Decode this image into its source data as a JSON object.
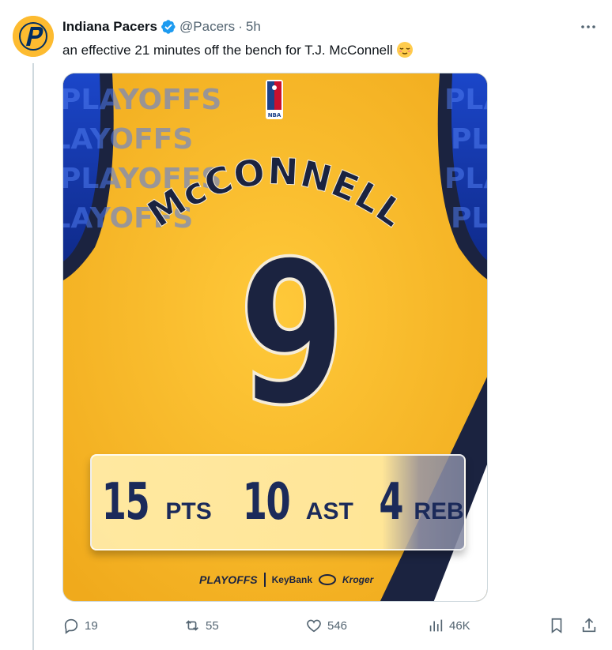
{
  "tweet": {
    "author_name": "Indiana Pacers",
    "handle": "@Pacers",
    "separator": "·",
    "time": "5h",
    "text": "an effective 21 minutes off the bench for T.J. McConnell"
  },
  "media": {
    "league_logo_text": "NBA",
    "background_text": "PLAYOFFS",
    "jersey_name": "McCONNELL",
    "jersey_number": "9",
    "stats": [
      {
        "value": "15",
        "label": "PTS"
      },
      {
        "value": "10",
        "label": "AST"
      },
      {
        "value": "4",
        "label": "REB"
      }
    ],
    "sponsors": {
      "playoffs": "PLAYOFFS",
      "keybank": "KeyBank",
      "kroger": "Kroger"
    },
    "colors": {
      "jersey_gold": "#f7b927",
      "navy": "#1b2340",
      "blue": "#1f4fd6"
    }
  },
  "actions": {
    "replies": "19",
    "reposts": "55",
    "likes": "546",
    "views": "46K"
  }
}
